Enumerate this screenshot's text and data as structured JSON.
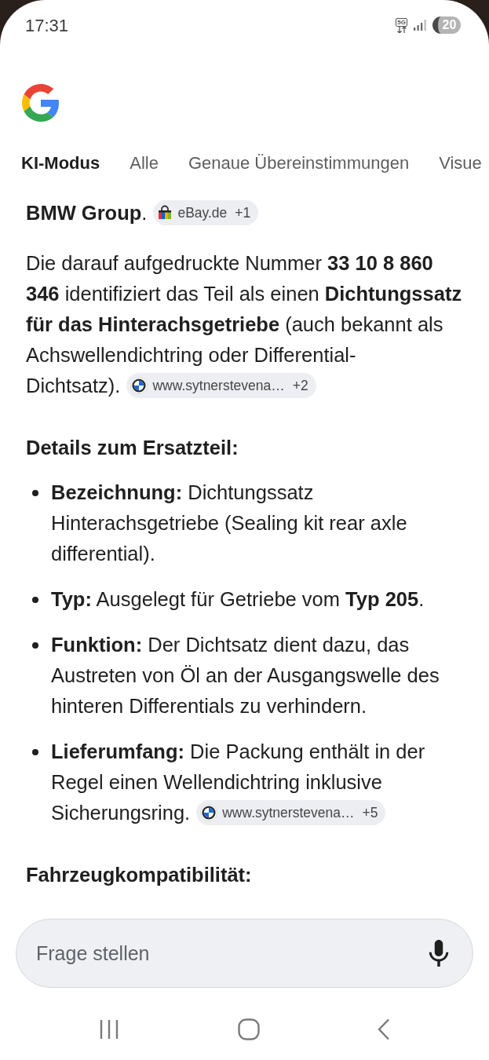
{
  "status_bar": {
    "time": "17:31",
    "network": "5G",
    "battery": "20"
  },
  "tabs": [
    {
      "label": "KI-Modus",
      "selected": true
    },
    {
      "label": "Alle",
      "selected": false
    },
    {
      "label": "Genaue Übereinstimmungen",
      "selected": false
    },
    {
      "label": "Visue",
      "selected": false
    }
  ],
  "answer": {
    "blocks": [
      {
        "kind": "paragraph",
        "text": "**BMW Group**.",
        "chip": {
          "kind": "bag",
          "source": "eBay.de",
          "more": "+1"
        }
      },
      {
        "kind": "paragraph",
        "text": "Die darauf aufgedruckte Nummer **33 10 8 860 346** identifiziert das Teil als einen **Dichtungssatz für das Hinterachsgetriebe** (auch bekannt als Achswellendichtring oder Differential-Dichtsatz).",
        "chip": {
          "kind": "roundel",
          "source": "www.sytnerstevena…",
          "more": "+2"
        }
      },
      {
        "kind": "heading",
        "text": "Details zum Ersatzteil:"
      },
      {
        "kind": "list",
        "items": [
          {
            "text": "**Bezeichnung:** Dichtungssatz Hinterachsgetriebe (Sealing kit rear axle differential)."
          },
          {
            "text": "**Typ:** Ausgelegt für Getriebe vom **Typ 205**."
          },
          {
            "text": "**Funktion:** Der Dichtsatz dient dazu, das Austreten von Öl an der Ausgangswelle des hinteren Differentials zu verhindern."
          },
          {
            "text": "**Lieferumfang:** Die Packung enthält in der Regel einen Wellendichtring inklusive Sicherungsring.",
            "chip": {
              "kind": "roundel",
              "source": "www.sytnerstevena…",
              "more": "+5"
            }
          }
        ]
      },
      {
        "kind": "heading",
        "text": "Fahrzeugkompatibilität:"
      }
    ]
  },
  "search": {
    "placeholder": "Frage stellen"
  }
}
